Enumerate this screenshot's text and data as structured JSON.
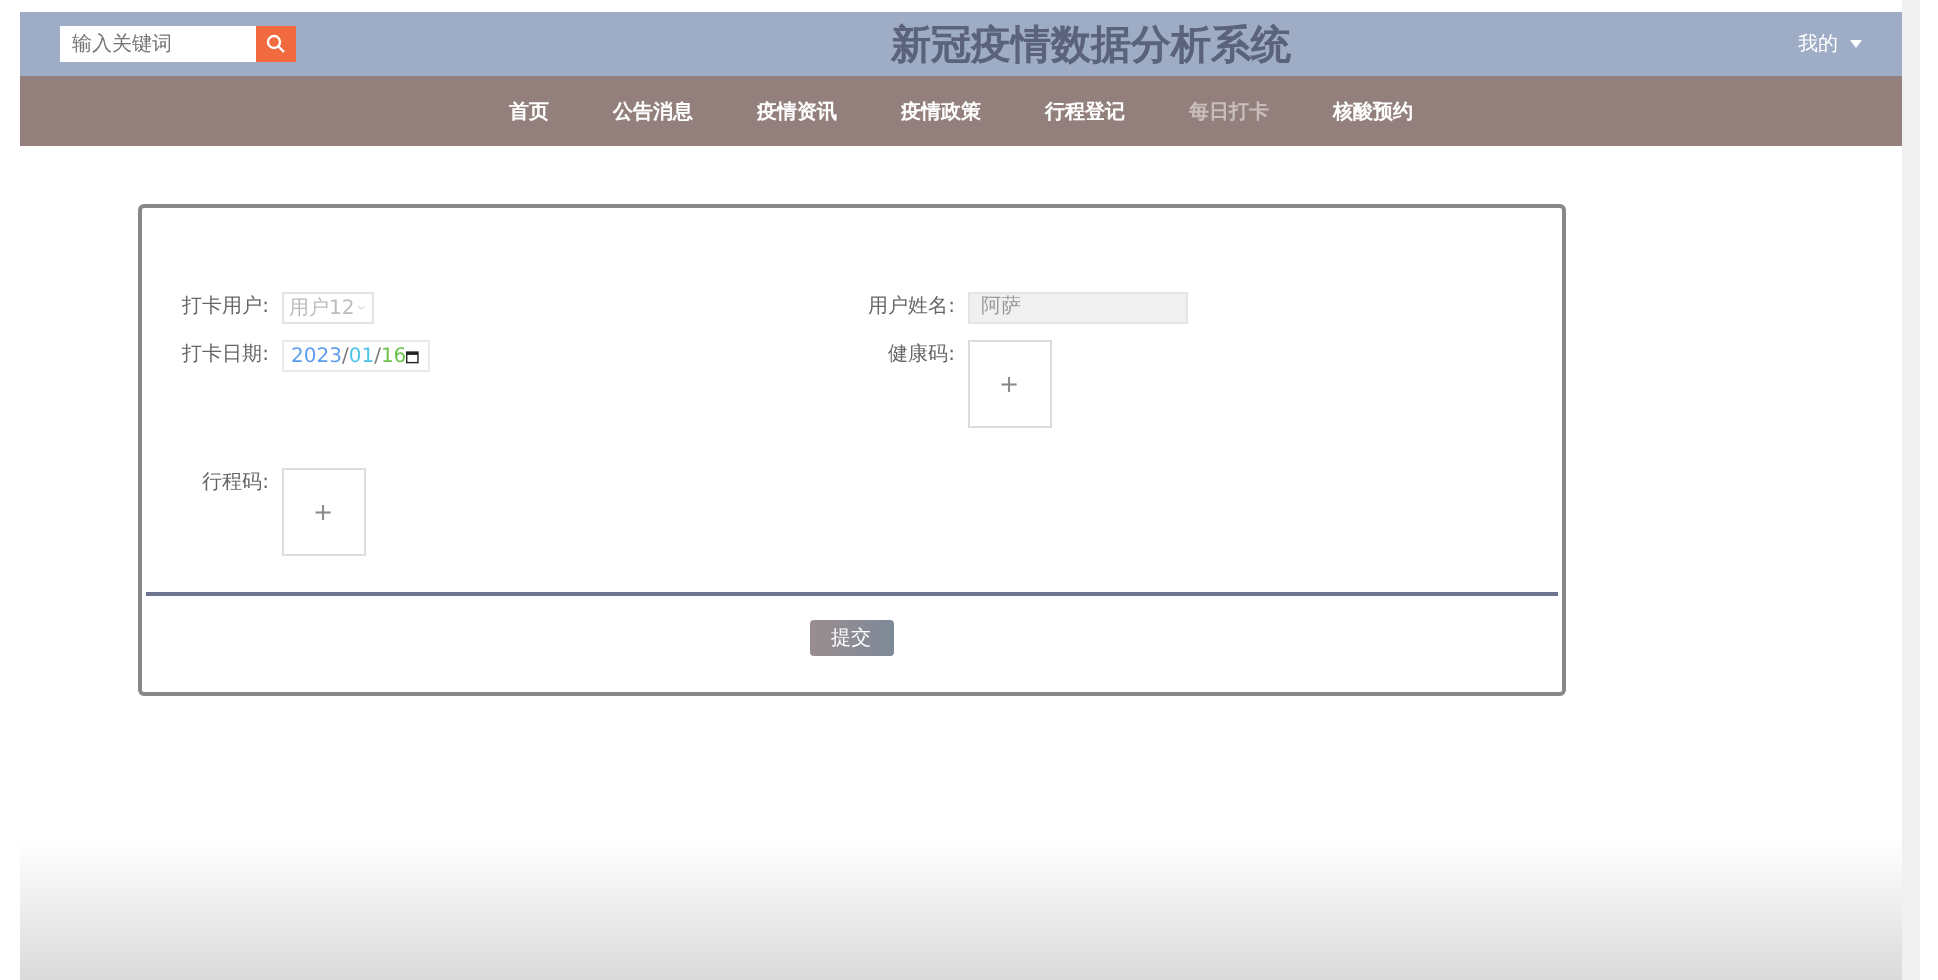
{
  "header": {
    "search": {
      "placeholder": "输入关键词"
    },
    "title": "新冠疫情数据分析系统",
    "user_menu": "我的"
  },
  "nav": [
    {
      "label": "首页",
      "selected": false
    },
    {
      "label": "公告消息",
      "selected": false
    },
    {
      "label": "疫情资讯",
      "selected": false
    },
    {
      "label": "疫情政策",
      "selected": false
    },
    {
      "label": "行程登记",
      "selected": false
    },
    {
      "label": "每日打卡",
      "selected": true
    },
    {
      "label": "核酸预约",
      "selected": false
    }
  ],
  "form": {
    "user": {
      "label": "打卡用户:",
      "value": "用户12",
      "disabled": true
    },
    "name": {
      "label": "用户姓名:",
      "value": "阿萨",
      "disabled": true
    },
    "date": {
      "label": "打卡日期:",
      "year": "2023",
      "separator": "/",
      "month": "01",
      "day": "16"
    },
    "health_code": {
      "label": "健康码:",
      "upload": "+"
    },
    "trip_code": {
      "label": "行程码:",
      "upload": "+"
    },
    "submit": "提交"
  }
}
